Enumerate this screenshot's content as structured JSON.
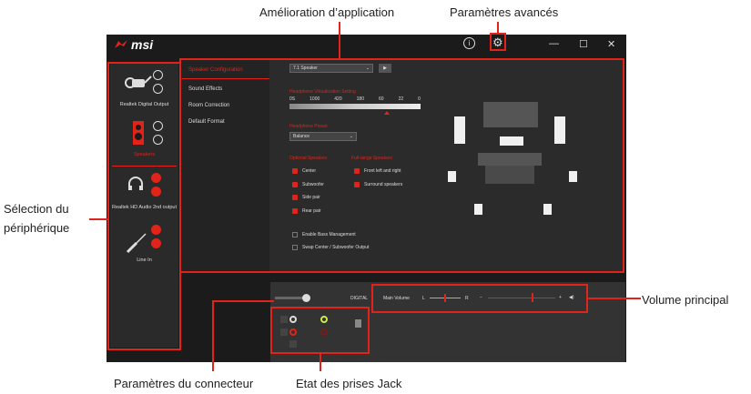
{
  "callouts": {
    "app_enhancement": "Amélioration d’application",
    "advanced_settings": "Paramètres avancés",
    "device_selection_1": "Sélection du",
    "device_selection_2": "périphérique",
    "main_volume": "Volume principal",
    "connector_settings": "Paramètres du connecteur",
    "jack_status": "Etat des prises Jack"
  },
  "window": {
    "logo": "msi",
    "controls": [
      "—",
      "☐",
      "✕"
    ]
  },
  "devices": [
    {
      "label": "Realtek Digital Output"
    },
    {
      "label": "Speakers"
    },
    {
      "label": "Realtek HD Audio 2nd output"
    },
    {
      "label": "Line In"
    }
  ],
  "menu": {
    "items": [
      "Speaker Configuration",
      "Sound Effects",
      "Room Correction",
      "Default Format"
    ]
  },
  "speaker_config": {
    "select_value": "7.1 Speaker",
    "play_glyph": "▶",
    "rate_label": "Headphone Virtualization Setting",
    "rate_values": [
      "0S",
      "1000",
      "420",
      "180",
      "60",
      "22",
      "0"
    ],
    "mode_label": "Headphone Preset",
    "mode_value": "Balance",
    "optional_label": "Optional Speakers",
    "fullrange_label": "Full-range Speakers",
    "optional": [
      "Center",
      "Subwoofer",
      "Side pair",
      "Rear pair"
    ],
    "fullrange": [
      "Front left and right",
      "Surround speakers"
    ],
    "options": [
      "Enable Bass Management",
      "Swap Center / Subwoofer Output"
    ]
  },
  "bottom": {
    "digital_label": "DIGITAL",
    "volume_label": "Main Volume",
    "L": "L",
    "R": "R",
    "minus": "−",
    "plus": "+"
  },
  "colors": {
    "accent": "#e2231a",
    "background": "#1b1b1b"
  }
}
